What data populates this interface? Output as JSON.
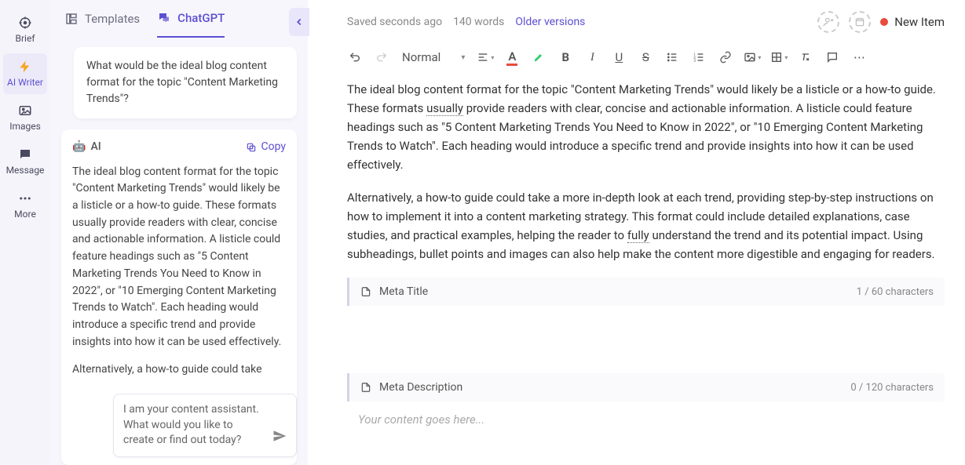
{
  "leftnav": {
    "brief": "Brief",
    "ai_writer": "AI Writer",
    "images": "Images",
    "message": "Message",
    "more": "More"
  },
  "tabs": {
    "templates": "Templates",
    "chatgpt": "ChatGPT"
  },
  "user_bubble": "What would be the ideal blog content format for the topic \"Content Marketing Trends\"?",
  "ai": {
    "name": "AI",
    "copy": "Copy",
    "p1": "The ideal blog content format for the topic \"Content Marketing Trends\" would likely be a listicle or a how-to guide. These formats usually provide readers with clear, concise and actionable information. A listicle could feature headings such as \"5 Content Marketing Trends You Need to Know in 2022\", or \"10 Emerging Content Marketing Trends to Watch\". Each heading would introduce a specific trend and provide insights into how it can be used effectively.",
    "p2": "Alternatively, a how-to guide could take"
  },
  "chat_placeholder": "I am your content assistant. What would you like to create or find out today?",
  "topbar": {
    "saved": "Saved seconds ago",
    "words": "140 words",
    "older": "Older versions",
    "new_item": "New Item"
  },
  "toolbar": {
    "para_style": "Normal"
  },
  "doc": {
    "p1a": "The ideal blog content format for the topic \"Content Marketing Trends\" would likely be a listicle or a how-to guide. These formats ",
    "p1_usually": "usually",
    "p1b": " provide readers with clear, concise and actionable information. A listicle could feature headings such as \"5 Content Marketing Trends You Need to Know in 2022\", or \"10 Emerging Content Marketing Trends to Watch\". Each heading would introduce a specific trend and provide insights into how it can be used effectively.",
    "p2a": "Alternatively, a how-to guide could take a more in-depth look at each trend, providing step-by-step instructions on how to implement it into a content marketing strategy. This format could include detailed explanations, case studies, and practical examples, helping the reader to ",
    "p2_fully": "fully",
    "p2b": " understand the trend and its potential impact. Using subheadings, bullet points and images can also help make the content more digestible and engaging for readers."
  },
  "meta": {
    "title_label": "Meta Title",
    "title_count": "1 / 60 characters",
    "desc_label": "Meta Description",
    "desc_count": "0 / 120 characters",
    "placeholder": "Your content goes here..."
  }
}
